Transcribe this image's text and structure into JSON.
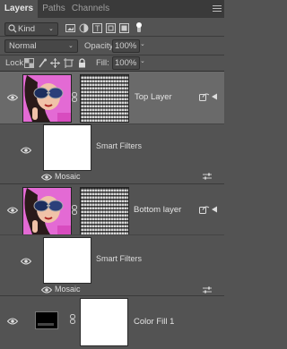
{
  "tabs": [
    {
      "label": "Layers",
      "active": true
    },
    {
      "label": "Paths",
      "active": false
    },
    {
      "label": "Channels",
      "active": false
    }
  ],
  "filter": {
    "kind_label": "Kind",
    "icon": "search-icon"
  },
  "blend": {
    "mode": "Normal",
    "opacity_label": "Opacity:",
    "opacity_value": "100%"
  },
  "lock": {
    "label": "Lock:",
    "fill_label": "Fill:",
    "fill_value": "100%"
  },
  "layers": [
    {
      "name": "Top Layer",
      "selected": true,
      "smart_filters_label": "Smart Filters",
      "filter_name": "Mosaic"
    },
    {
      "name": "Bottom layer",
      "selected": false,
      "smart_filters_label": "Smart Filters",
      "filter_name": "Mosaic"
    },
    {
      "name": "Color Fill 1",
      "selected": false
    }
  ],
  "colors": {
    "panel_bg": "#535353",
    "tab_bg": "#3a3a3a",
    "selected_row": "#6a6a6a",
    "thumb_pink": "#e05fd0"
  }
}
